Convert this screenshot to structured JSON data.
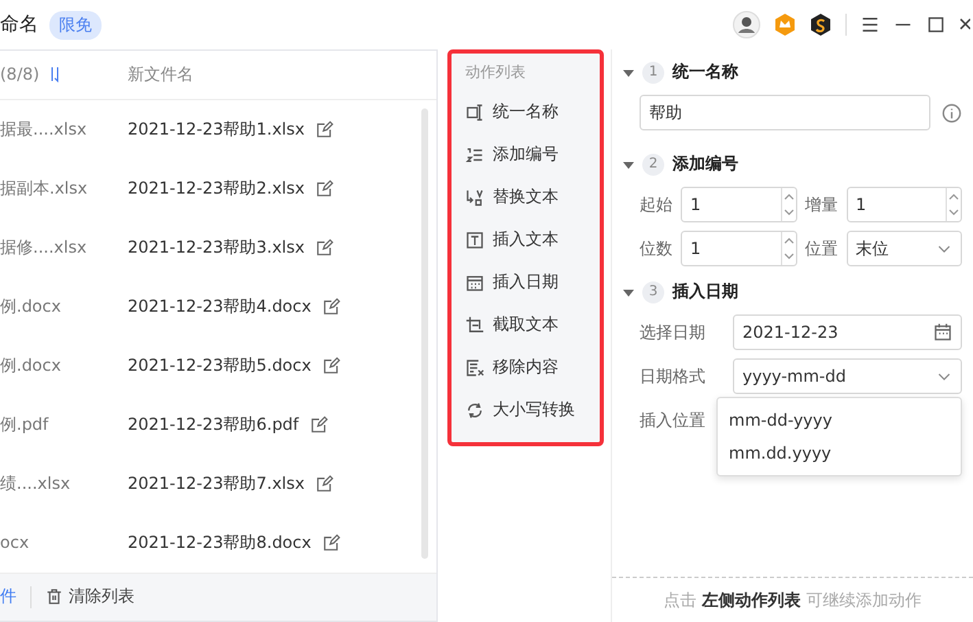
{
  "title_bar": {
    "title": "命名",
    "badge": "限免"
  },
  "file_list": {
    "columns": [
      "(8/8)",
      "新文件名"
    ],
    "rows": [
      {
        "original": "据最....xlsx",
        "renamed": "2021-12-23帮助1.xlsx"
      },
      {
        "original": "据副本.xlsx",
        "renamed": "2021-12-23帮助2.xlsx"
      },
      {
        "original": "据修....xlsx",
        "renamed": "2021-12-23帮助3.xlsx"
      },
      {
        "original": "例.docx",
        "renamed": "2021-12-23帮助4.docx"
      },
      {
        "original": "例.docx",
        "renamed": "2021-12-23帮助5.docx"
      },
      {
        "original": "例.pdf",
        "renamed": "2021-12-23帮助6.pdf"
      },
      {
        "original": "绩....xlsx",
        "renamed": "2021-12-23帮助7.xlsx"
      },
      {
        "original": "ocx",
        "renamed": "2021-12-23帮助8.docx"
      }
    ],
    "footer": {
      "add_label": "件",
      "clear_label": "清除列表"
    }
  },
  "action_list": {
    "title": "动作列表",
    "items": [
      "统一名称",
      "添加编号",
      "替换文本",
      "插入文本",
      "插入日期",
      "截取文本",
      "移除内容",
      "大小写转换"
    ]
  },
  "settings": [
    {
      "number": "1",
      "title": "统一名称",
      "expanded": true,
      "kind": "name",
      "value": "帮助"
    },
    {
      "number": "2",
      "title": "添加编号",
      "expanded": true,
      "kind": "numbering",
      "fields": [
        {
          "label": "起始",
          "value": "1",
          "kind": "spinner"
        },
        {
          "label": "增量",
          "value": "1",
          "kind": "spinner"
        },
        {
          "label": "位数",
          "value": "1",
          "kind": "spinner"
        },
        {
          "label": "位置",
          "value": "末位",
          "kind": "select"
        }
      ]
    },
    {
      "number": "3",
      "title": "插入日期",
      "expanded": true,
      "kind": "date",
      "fields": [
        {
          "label": "选择日期",
          "value": "2021-12-23",
          "kind": "date"
        },
        {
          "label": "日期格式",
          "value": "yyyy-mm-dd",
          "kind": "select",
          "open": true,
          "options": [
            "mm-dd-yyyy",
            "mm.dd.yyyy"
          ]
        },
        {
          "label": "插入位置",
          "kind": "hidden"
        }
      ]
    }
  ],
  "hint": "点击 **左侧动作列表** 可继续添加动作"
}
